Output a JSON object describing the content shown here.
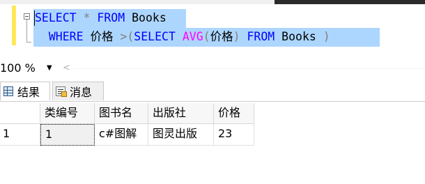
{
  "editor": {
    "line1": {
      "kw_select": "SELECT",
      "star": "*",
      "kw_from": "FROM",
      "table": "Books"
    },
    "line2": {
      "kw_where": "WHERE",
      "col": "价格",
      "gt": ">",
      "open_paren": "(",
      "kw_select": "SELECT",
      "fn_avg": "AVG",
      "avg_open": "(",
      "avg_col": "价格",
      "avg_close": ")",
      "kw_from": "FROM",
      "table": "Books",
      "close_paren": ")"
    }
  },
  "zoom": {
    "value": "100 %"
  },
  "tabs": {
    "results": "结果",
    "messages": "消息"
  },
  "grid": {
    "columns": [
      "类编号",
      "图书名",
      "出版社",
      "价格"
    ],
    "rows": [
      {
        "rownum": "1",
        "cells": [
          "1",
          "c#图解",
          "图灵出版",
          "23"
        ]
      }
    ]
  },
  "colors": {
    "keyword": "#0000ff",
    "operator": "#808080",
    "function": "#ff00ff",
    "selection": "#add6ff",
    "change_margin": "#ffe95a"
  }
}
